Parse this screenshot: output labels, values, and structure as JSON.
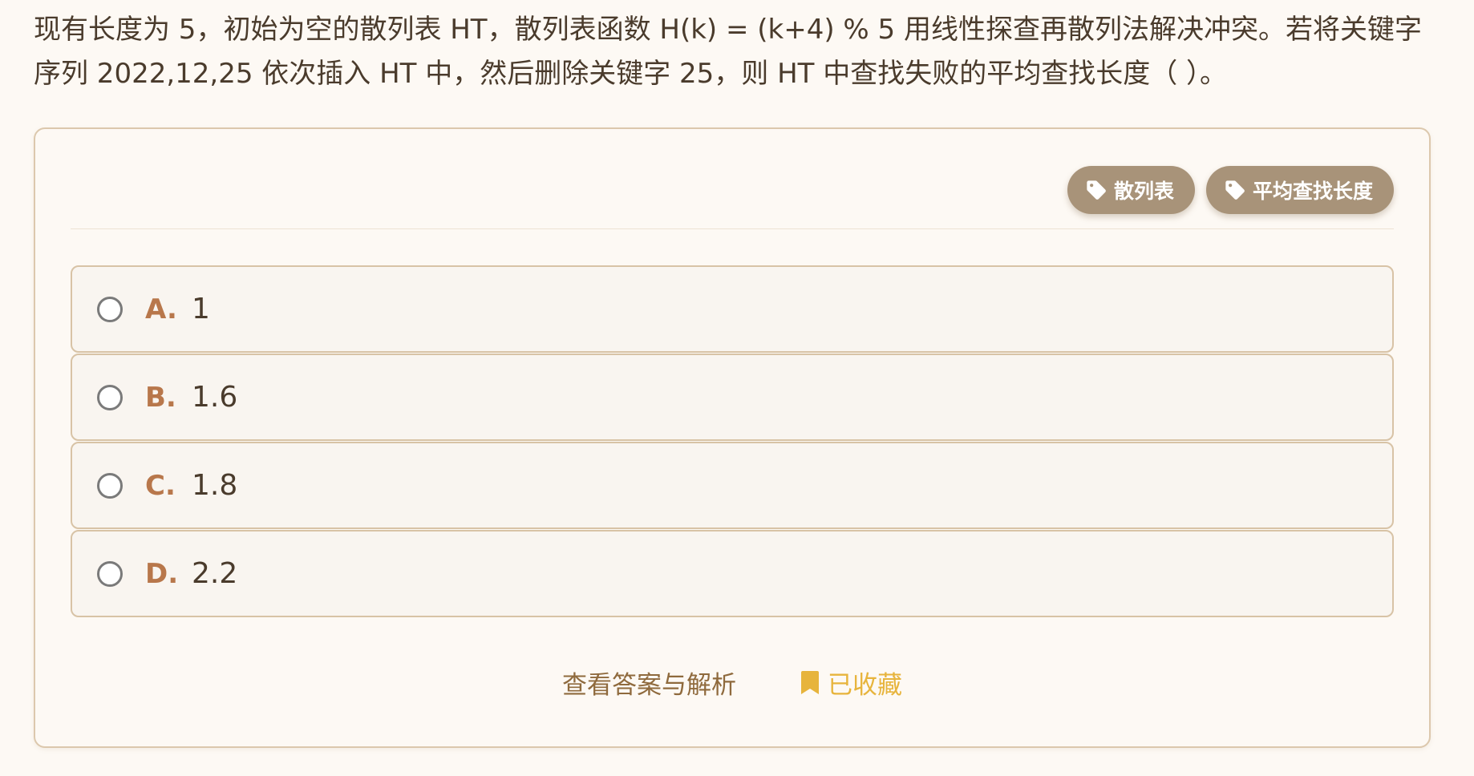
{
  "question": {
    "text": "现有长度为 5，初始为空的散列表 HT，散列表函数 H(k) = (k+4) % 5 用线性探查再散列法解决冲突。若将关键字序列 2022,12,25 依次插入 HT 中，然后删除关键字 25，则 HT 中查找失败的平均查找长度（  ）。"
  },
  "tags": [
    {
      "label": "散列表",
      "icon": "tag-icon"
    },
    {
      "label": "平均查找长度",
      "icon": "tag-icon"
    }
  ],
  "options": [
    {
      "letter": "A.",
      "value": "1"
    },
    {
      "letter": "B.",
      "value": "1.6"
    },
    {
      "letter": "C.",
      "value": "1.8"
    },
    {
      "letter": "D.",
      "value": "2.2"
    }
  ],
  "actions": {
    "view_answer": "查看答案与解析",
    "favorite": "已收藏",
    "favorite_icon": "bookmark-icon"
  },
  "colors": {
    "background": "#fdf9f4",
    "tag_bg": "#a89379",
    "option_letter": "#b8774b",
    "option_border": "#d8c3a6",
    "favorite": "#e7b43c",
    "link": "#8f6a3d"
  }
}
